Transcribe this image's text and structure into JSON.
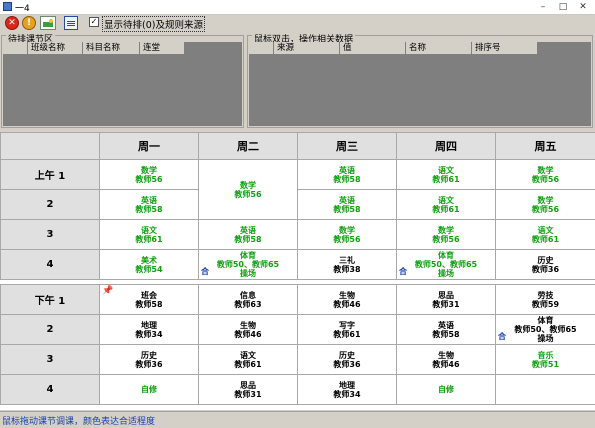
{
  "window": {
    "title": "一4"
  },
  "toolbar": {
    "show_label": "显示待排(0)及规则来源",
    "checked": "✓"
  },
  "left_group": {
    "legend": "待排课节区",
    "columns": [
      "班级名称",
      "科目名称",
      "连堂"
    ]
  },
  "right_group": {
    "legend": "鼠标双击，操作相关数据",
    "columns": [
      "来源",
      "值",
      "名称",
      "排序号"
    ]
  },
  "days": [
    "周一",
    "周二",
    "周三",
    "周四",
    "周五"
  ],
  "morning": [
    {
      "period": "上午 1",
      "cells": [
        {
          "subj": "数学",
          "tch": "教师56",
          "color": "g"
        },
        {
          "subj": "数学",
          "tch": "教师56",
          "color": "g",
          "rowspan": 2
        },
        {
          "subj": "英语",
          "tch": "教师58",
          "color": "g"
        },
        {
          "subj": "语文",
          "tch": "教师61",
          "color": "g"
        },
        {
          "subj": "数学",
          "tch": "教师56",
          "color": "g"
        }
      ]
    },
    {
      "period": "2",
      "cells": [
        {
          "subj": "英语",
          "tch": "教师58",
          "color": "g"
        },
        null,
        {
          "subj": "英语",
          "tch": "教师58",
          "color": "g"
        },
        {
          "subj": "语文",
          "tch": "教师61",
          "color": "g"
        },
        {
          "subj": "数学",
          "tch": "教师56",
          "color": "g"
        }
      ]
    },
    {
      "period": "3",
      "cells": [
        {
          "subj": "语文",
          "tch": "教师61",
          "color": "g"
        },
        {
          "subj": "英语",
          "tch": "教师58",
          "color": "g"
        },
        {
          "subj": "数学",
          "tch": "教师56",
          "color": "g"
        },
        {
          "subj": "数学",
          "tch": "教师56",
          "color": "g"
        },
        {
          "subj": "语文",
          "tch": "教师61",
          "color": "g"
        }
      ]
    },
    {
      "period": "4",
      "cells": [
        {
          "subj": "美术",
          "tch": "教师54",
          "color": "g"
        },
        {
          "subj": "体育",
          "tch": "教师50、教师65",
          "extra": "操场",
          "color": "g",
          "mark": "合"
        },
        {
          "subj": "三礼",
          "tch": "教师38",
          "color": "k"
        },
        {
          "subj": "体育",
          "tch": "教师50、教师65",
          "extra": "操场",
          "color": "g",
          "mark": "合"
        },
        {
          "subj": "历史",
          "tch": "教师36",
          "color": "k"
        }
      ]
    }
  ],
  "afternoon": [
    {
      "period": "下午 1",
      "cells": [
        {
          "subj": "班会",
          "tch": "教师58",
          "color": "k",
          "pin": "📌"
        },
        {
          "subj": "信息",
          "tch": "教师63",
          "color": "k"
        },
        {
          "subj": "生物",
          "tch": "教师46",
          "color": "k"
        },
        {
          "subj": "思品",
          "tch": "教师31",
          "color": "k"
        },
        {
          "subj": "劳技",
          "tch": "教师59",
          "color": "k"
        }
      ]
    },
    {
      "period": "2",
      "cells": [
        {
          "subj": "地理",
          "tch": "教师34",
          "color": "k"
        },
        {
          "subj": "生物",
          "tch": "教师46",
          "color": "k"
        },
        {
          "subj": "写字",
          "tch": "教师61",
          "color": "k"
        },
        {
          "subj": "英语",
          "tch": "教师58",
          "color": "k"
        },
        {
          "subj": "体育",
          "tch": "教师50、教师65",
          "extra": "操场",
          "color": "k",
          "mark": "合"
        }
      ]
    },
    {
      "period": "3",
      "cells": [
        {
          "subj": "历史",
          "tch": "教师36",
          "color": "k"
        },
        {
          "subj": "语文",
          "tch": "教师61",
          "color": "k"
        },
        {
          "subj": "历史",
          "tch": "教师36",
          "color": "k"
        },
        {
          "subj": "生物",
          "tch": "教师46",
          "color": "k"
        },
        {
          "subj": "音乐",
          "tch": "教师51",
          "color": "g"
        }
      ]
    },
    {
      "period": "4",
      "cells": [
        {
          "subj": "自修",
          "tch": "",
          "color": "g"
        },
        {
          "subj": "思品",
          "tch": "教师31",
          "color": "k"
        },
        {
          "subj": "地理",
          "tch": "教师34",
          "color": "k"
        },
        {
          "subj": "自修",
          "tch": "",
          "color": "g"
        },
        {
          "subj": "",
          "tch": "",
          "color": "k"
        }
      ]
    }
  ],
  "status": {
    "text": "鼠标拖动课节调课，颜色表达合适程度"
  }
}
